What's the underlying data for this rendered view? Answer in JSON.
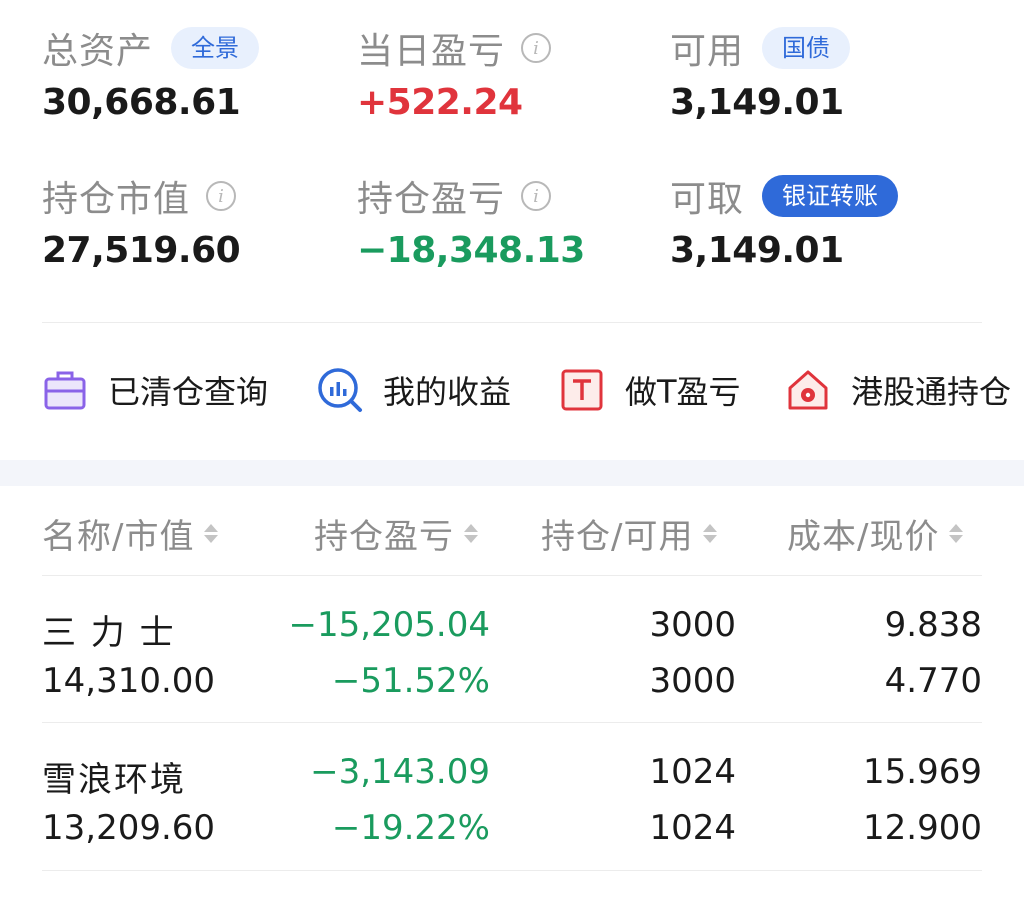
{
  "summary": {
    "total_assets": {
      "label": "总资产",
      "tag": "全景",
      "value": "30,668.61"
    },
    "daily_pl": {
      "label": "当日盈亏",
      "value": "+522.24",
      "info_icon": "info-icon"
    },
    "available": {
      "label": "可用",
      "tag": "国债",
      "value": "3,149.01"
    },
    "position_value": {
      "label": "持仓市值",
      "value": "27,519.60",
      "info_icon": "info-icon"
    },
    "position_pl": {
      "label": "持仓盈亏",
      "value": "−18,348.13",
      "info_icon": "info-icon"
    },
    "withdrawable": {
      "label": "可取",
      "tag": "银证转账",
      "value": "3,149.01"
    }
  },
  "actions": [
    {
      "label": "已清仓查询",
      "icon": "briefcase-icon"
    },
    {
      "label": "我的收益",
      "icon": "chart-search-icon"
    },
    {
      "label": "做T盈亏",
      "icon": "t-box-icon"
    },
    {
      "label": "港股通持仓",
      "icon": "hk-house-icon"
    }
  ],
  "table": {
    "headers": [
      "名称/市值",
      "持仓盈亏",
      "持仓/可用",
      "成本/现价"
    ],
    "rows": [
      {
        "name": "三 力 士",
        "market_value": "14,310.00",
        "pl": "−15,205.04",
        "pl_pct": "−51.52%",
        "position": "3000",
        "available": "3000",
        "cost": "9.838",
        "price": "4.770"
      },
      {
        "name": "雪浪环境",
        "market_value": "13,209.60",
        "pl": "−3,143.09",
        "pl_pct": "−19.22%",
        "position": "1024",
        "available": "1024",
        "cost": "15.969",
        "price": "12.900"
      }
    ]
  },
  "colors": {
    "up": "#e0343c",
    "down": "#1a9b5e",
    "accent": "#2f6ad9",
    "label": "#8c8c8c"
  }
}
